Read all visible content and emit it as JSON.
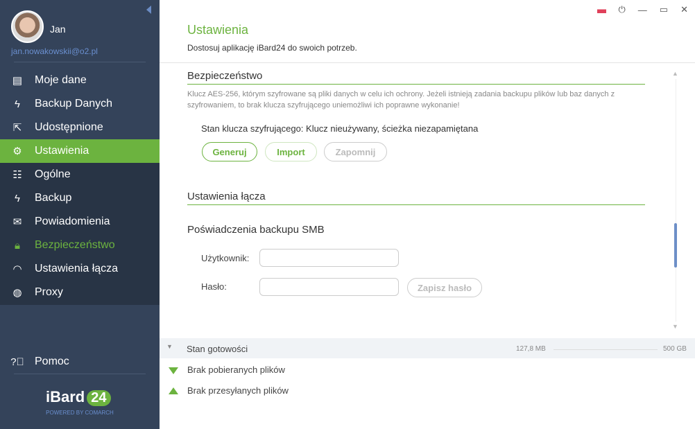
{
  "user": {
    "name": "Jan",
    "email": "jan.nowakowskii@o2.pl"
  },
  "nav": [
    {
      "label": "Moje dane",
      "icon": "document-icon"
    },
    {
      "label": "Backup Danych",
      "icon": "lightning-icon"
    },
    {
      "label": "Udostępnione",
      "icon": "share-icon"
    },
    {
      "label": "Ustawienia",
      "icon": "gear-icon",
      "active": true
    },
    {
      "label": "Ogólne",
      "icon": "toggles-icon"
    },
    {
      "label": "Backup",
      "icon": "lightning-icon"
    },
    {
      "label": "Powiadomienia",
      "icon": "envelope-icon"
    },
    {
      "label": "Bezpieczeństwo",
      "icon": "lock-icon",
      "selected": true
    },
    {
      "label": "Ustawienia łącza",
      "icon": "speedometer-icon"
    },
    {
      "label": "Proxy",
      "icon": "globe-icon"
    }
  ],
  "help": "Pomoc",
  "logo": {
    "text": "iBard",
    "badge": "24",
    "powered": "POWERED BY COMARCH"
  },
  "header": {
    "title": "Ustawienia",
    "subtitle": "Dostosuj aplikację iBard24 do swoich potrzeb."
  },
  "security": {
    "heading": "Bezpieczeństwo",
    "description": "Klucz  AES-256, którym szyfrowane są  pliki danych w celu ich ochrony. Jeżeli istnieją zadania backupu plików lub baz danych z szyfrowaniem, to brak klucza szyfrującego uniemożliwi ich poprawne wykonanie!",
    "status": "Stan klucza szyfrującego: Klucz nieużywany, ścieżka niezapamiętana",
    "buttons": {
      "generate": "Generuj",
      "import": "Import",
      "forget": "Zapomnij"
    }
  },
  "link": {
    "heading": "Ustawienia łącza",
    "smb_heading": "Poświadczenia backupu SMB",
    "user_label": "Użytkownik:",
    "user_value": "",
    "password_label": "Hasło:",
    "password_value": "",
    "save_password": "Zapisz hasło"
  },
  "statusbar": {
    "state": "Stan gotowości",
    "used": "127,8 MB",
    "total": "500 GB",
    "downloads": "Brak pobieranych plików",
    "uploads": "Brak przesyłanych plików"
  },
  "colors": {
    "accent": "#6cb33f",
    "sidebar": "#34435a",
    "link": "#6a8fcf"
  }
}
